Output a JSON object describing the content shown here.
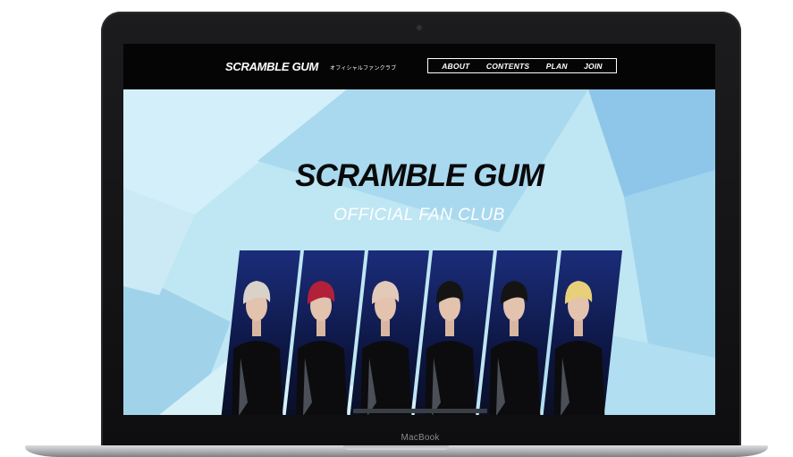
{
  "device": {
    "label": "MacBook"
  },
  "site": {
    "brand": "SCRAMBLE GUM",
    "brand_sub": "オフィシャルファンクラブ",
    "nav": [
      {
        "label": "ABOUT"
      },
      {
        "label": "CONTENTS"
      },
      {
        "label": "PLAN"
      },
      {
        "label": "JOIN"
      }
    ]
  },
  "hero": {
    "title": "SCRAMBLE GUM",
    "subtitle": "OFFICIAL FAN CLUB",
    "members": 6,
    "colors": {
      "background": "#b9e3f2",
      "photo_bg": "#101b4a",
      "hair": [
        "#d8d2c8",
        "#b2203a",
        "#e3c9b9",
        "#141414",
        "#141414",
        "#e8d07a"
      ]
    }
  }
}
